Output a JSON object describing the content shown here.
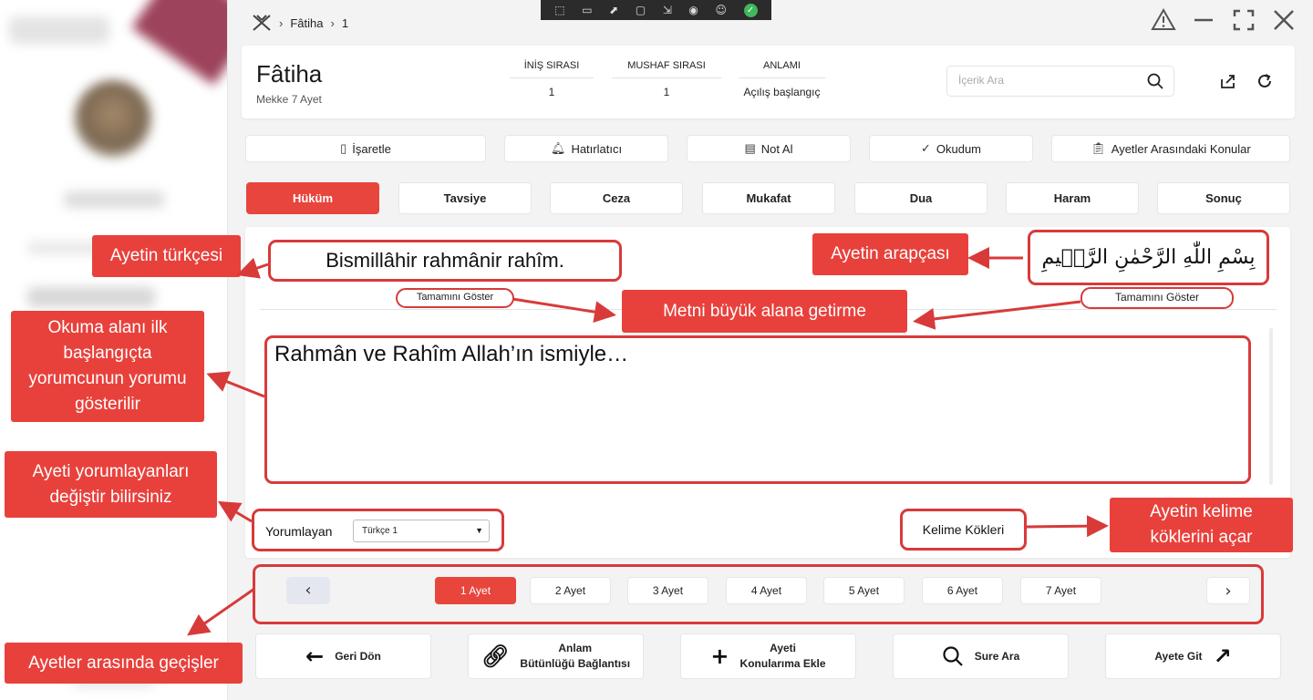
{
  "breadcrumb": {
    "sura": "Fâtiha",
    "ayah": "1"
  },
  "toolbar_icons": [
    "select-region-icon",
    "record-icon",
    "pointer-icon",
    "window-icon",
    "cursor-icon",
    "wireless-icon",
    "accessibility-icon",
    "check-icon"
  ],
  "header": {
    "title": "Fâtiha",
    "place": "Mekke",
    "ayah_count": "7",
    "ayah_word": "Ayet",
    "stats": [
      {
        "label": "İNİŞ SIRASI",
        "value": "1"
      },
      {
        "label": "MUSHAF SIRASI",
        "value": "1"
      },
      {
        "label": "ANLAMI",
        "value": "Açılış başlangıç"
      }
    ],
    "search_placeholder": "İçerik Ara"
  },
  "actions": [
    {
      "icon": "bookmark-icon",
      "label": "İşaretle"
    },
    {
      "icon": "bell-icon",
      "label": "Hatırlatıcı"
    },
    {
      "icon": "note-icon",
      "label": "Not Al"
    },
    {
      "icon": "check-icon",
      "label": "Okudum"
    },
    {
      "icon": "clipboard-icon",
      "label": "Ayetler Arasındaki Konular"
    }
  ],
  "categories": [
    "Hüküm",
    "Tavsiye",
    "Ceza",
    "Mukafat",
    "Dua",
    "Haram",
    "Sonuç"
  ],
  "active_category": "Hüküm",
  "reading": {
    "turkish": "Bismillâhir rahmânir rahîm.",
    "arabic": "بِسْمِ اللّٰهِ الرَّحْمٰنِ الرَّح۪يمِ",
    "show_all": "Tamamını Göster",
    "commentary": "Rahmân ve Rahîm Allah’ın ismiyle…",
    "commentator_label": "Yorumlayan",
    "commentator_value": "Türkçe 1",
    "word_roots": "Kelime Kökleri"
  },
  "pager": {
    "items": [
      "1 Ayet",
      "2 Ayet",
      "3 Ayet",
      "4 Ayet",
      "5 Ayet",
      "6 Ayet",
      "7 Ayet"
    ],
    "active": "1 Ayet"
  },
  "bottom_buttons": [
    {
      "icon": "arrow-left-icon",
      "label": "Geri Dön"
    },
    {
      "icon": "link-icon",
      "label_line1": "Anlam",
      "label_line2": "Bütünlüğü  Bağlantısı"
    },
    {
      "icon": "plus-icon",
      "label_line1": "Ayeti",
      "label_line2": "Konularıma Ekle"
    },
    {
      "icon": "search-icon",
      "label": "Sure Ara"
    },
    {
      "icon": "arrow-up-right-icon",
      "label": "Ayete Git"
    }
  ],
  "annotations": {
    "turkish": "Ayetin türkçesi",
    "arabic": "Ayetin arapçası",
    "enlarge": "Metni büyük alana getirme",
    "reading_area": "Okuma alanı ilk başlangıçta yorumcunun yorumu gösterilir",
    "commentators": "Ayeti yorumlayanları değiştir bilirsiniz",
    "word_roots": "Ayetin kelime köklerini açar",
    "navigation": "Ayetler arasında geçişler"
  },
  "colors": {
    "accent": "#e8453c",
    "callout": "#e8413c",
    "outline": "#d83a3a"
  }
}
